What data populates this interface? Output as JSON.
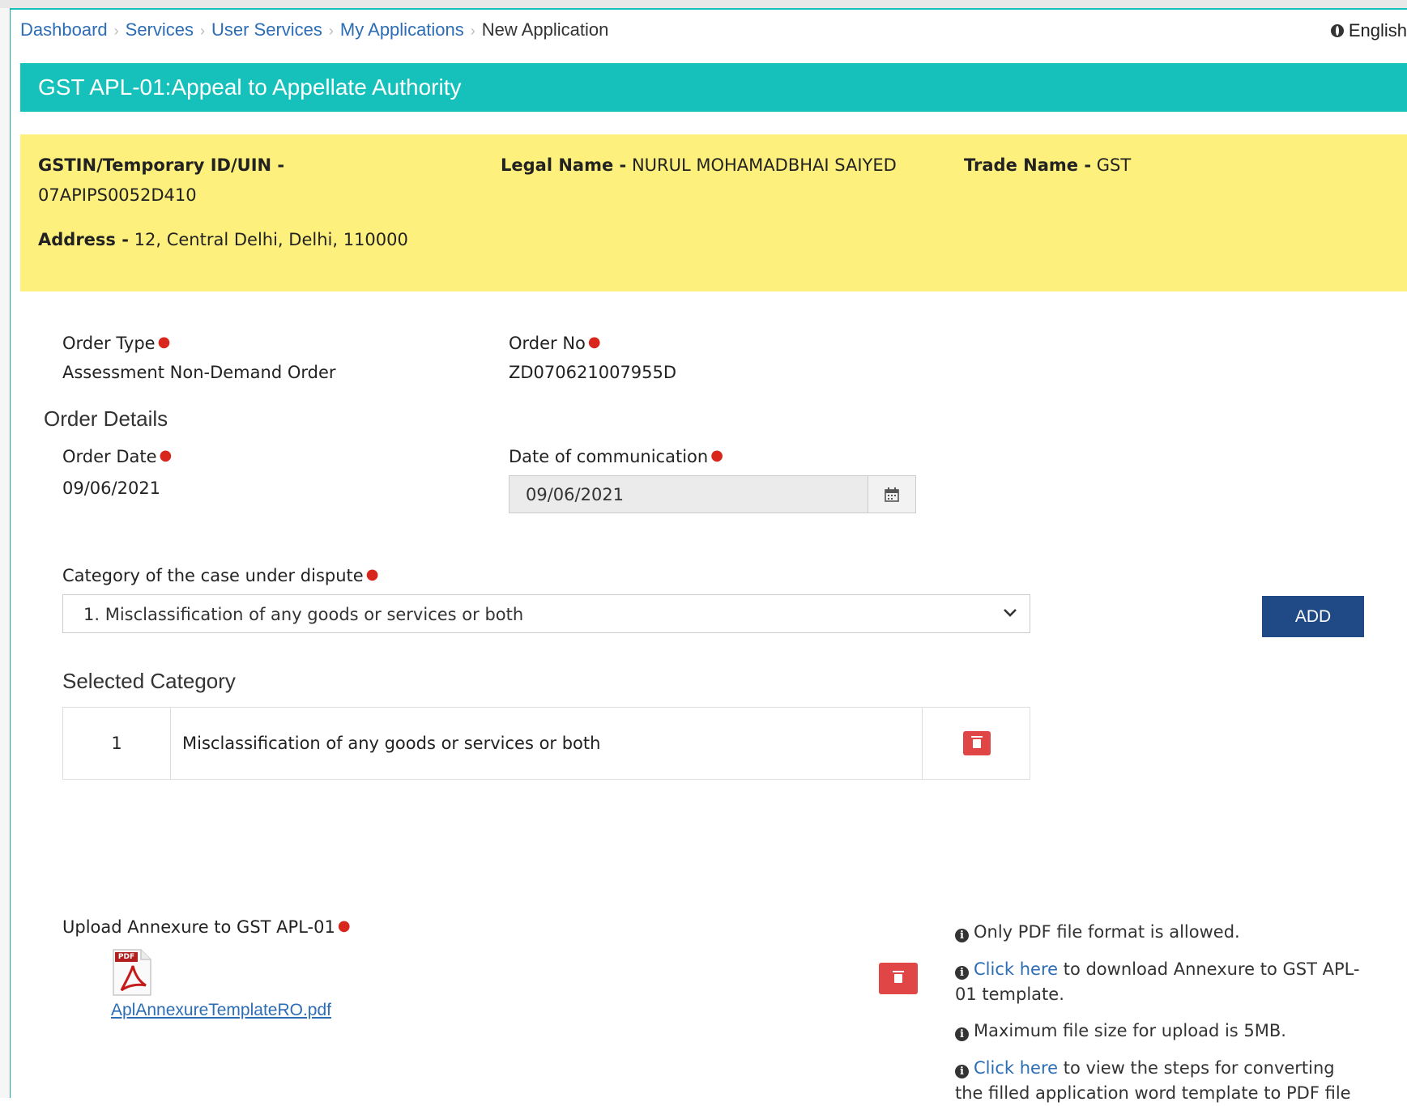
{
  "breadcrumb": [
    "Dashboard",
    "Services",
    "User Services",
    "My Applications"
  ],
  "breadcrumb_current": "New Application",
  "language": "English",
  "page_title": "GST APL-01:Appeal to Appellate Authority",
  "taxpayer": {
    "gstin_label": "GSTIN/Temporary ID/UIN",
    "gstin_value": "07APIPS0052D410",
    "legal_name_label": "Legal Name",
    "legal_name_value": "NURUL MOHAMADBHAI SAIYED",
    "trade_name_label": "Trade Name",
    "trade_name_value": "GST",
    "address_label": "Address",
    "address_value": "12, Central Delhi, Delhi, 110000"
  },
  "order": {
    "type_label": "Order Type",
    "type_value": "Assessment Non-Demand Order",
    "no_label": "Order No",
    "no_value": "ZD070621007955D"
  },
  "order_details": {
    "heading": "Order Details",
    "date_label": "Order Date",
    "date_value": "09/06/2021",
    "comm_label": "Date of communication",
    "comm_value": "09/06/2021"
  },
  "category": {
    "label": "Category of the case under dispute",
    "selected": "1. Misclassification of any goods or services or both",
    "add_label": "ADD",
    "selected_heading": "Selected Category",
    "rows": [
      {
        "no": "1",
        "name": "Misclassification of any goods or services or both"
      }
    ]
  },
  "upload": {
    "label": "Upload Annexure to GST APL-01",
    "pdf_badge": "PDF",
    "file_name": "AplAnnexureTemplateRO.pdf"
  },
  "notes": {
    "n1": "Only PDF file format is allowed.",
    "n2_link": "Click here",
    "n2_text": " to download Annexure to GST APL-01 template.",
    "n3": "Maximum file size for upload is 5MB.",
    "n4_link": "Click here",
    "n4_text": " to view the steps for converting the filled application word template to PDF file"
  },
  "colors": {
    "teal": "#17c1bb",
    "yellow": "#fdf07c",
    "navy": "#1f4a85",
    "red": "#e04646",
    "link": "#2c6db5"
  }
}
